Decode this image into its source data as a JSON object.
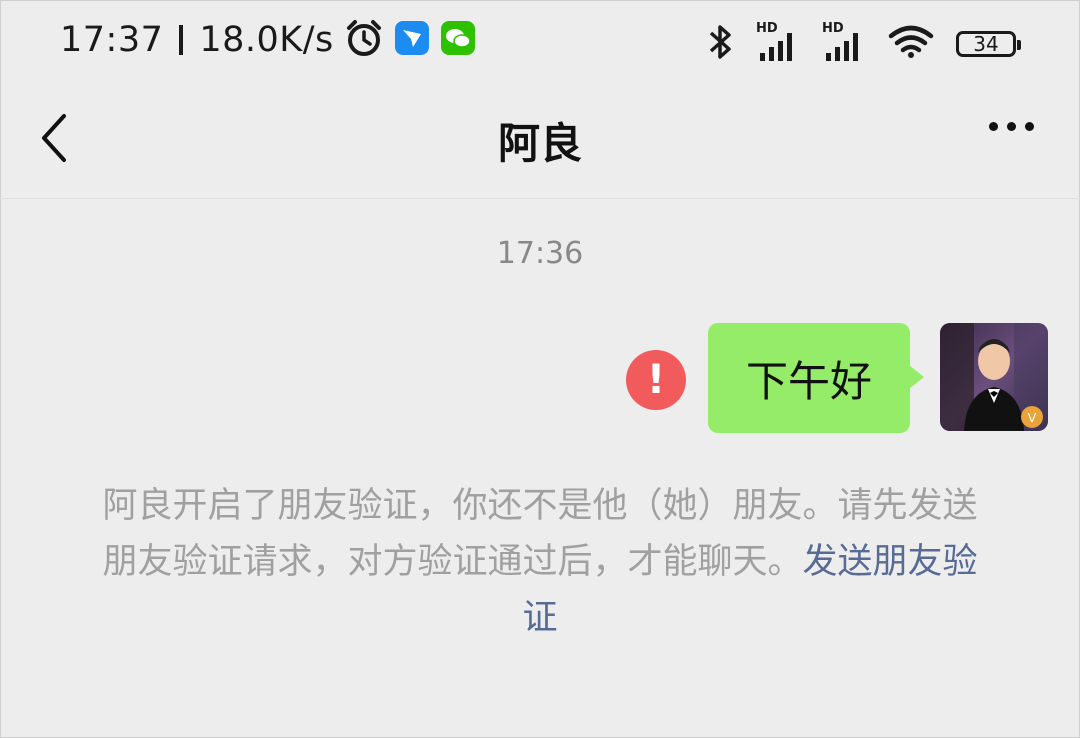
{
  "status_bar": {
    "time": "17:37",
    "net_speed": "18.0K/s",
    "hd_1": "HD",
    "hd_2": "HD",
    "battery": "34",
    "icons": [
      "alarm-icon",
      "app-notification-icon",
      "wechat-icon",
      "bluetooth-icon",
      "signal-icon",
      "wifi-icon",
      "battery-icon"
    ]
  },
  "header": {
    "title": "阿良"
  },
  "chat": {
    "timestamp": "17:36",
    "messages": [
      {
        "text": "下午好",
        "sender": "self",
        "status": "failed"
      }
    ],
    "system_notice": {
      "text": "阿良开启了朋友验证，你还不是他（她）朋友。请先发送朋友验证请求，对方验证通过后，才能聊天。",
      "link": "发送朋友验证"
    }
  },
  "colors": {
    "bubble": "#95ec69",
    "error": "#f25b5b",
    "link": "#576b95",
    "background": "#ededed"
  }
}
